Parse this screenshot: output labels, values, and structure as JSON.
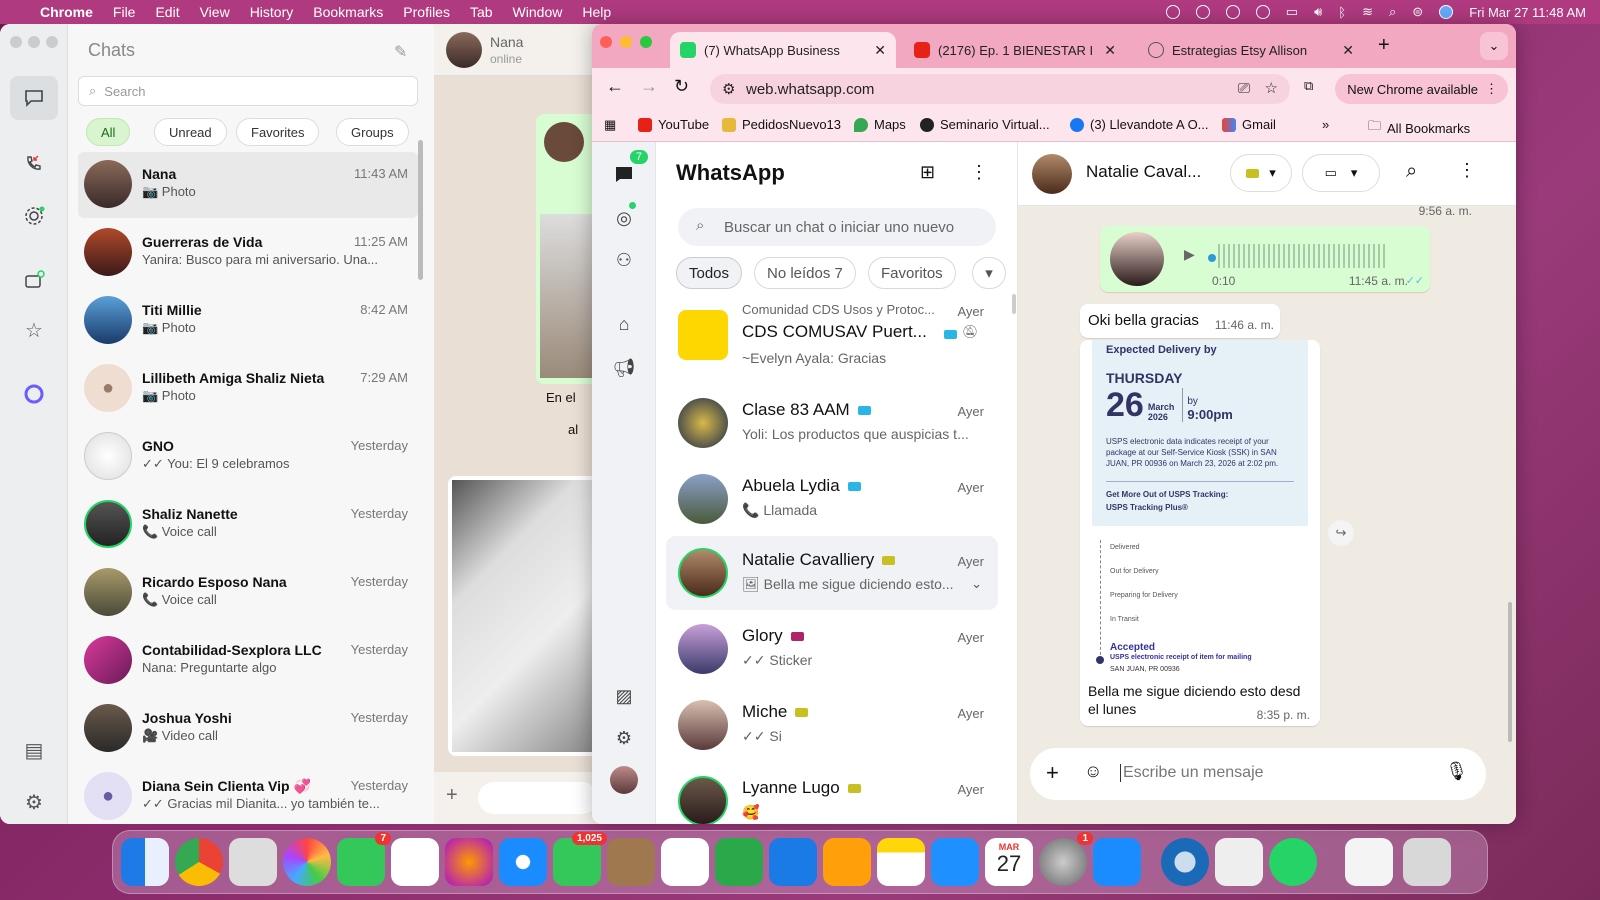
{
  "menubar": {
    "app": "Chrome",
    "items": [
      "File",
      "Edit",
      "View",
      "History",
      "Bookmarks",
      "Profiles",
      "Tab",
      "Window",
      "Help"
    ],
    "datetime": "Fri Mar 27  11:48 AM"
  },
  "messages_app": {
    "title": "Chats",
    "search_placeholder": "Search",
    "filters": [
      "All",
      "Unread",
      "Favorites",
      "Groups"
    ],
    "chats": [
      {
        "name": "Nana",
        "preview": "📷 Photo",
        "time": "11:43 AM"
      },
      {
        "name": "Guerreras de Vida",
        "preview": "Yanira: Busco para mi aniversario. Una...",
        "time": "11:25 AM"
      },
      {
        "name": "Titi Millie",
        "preview": "📷 Photo",
        "time": "8:42 AM"
      },
      {
        "name": "Lillibeth Amiga Shaliz Nieta",
        "preview": "📷 Photo",
        "time": "7:29 AM"
      },
      {
        "name": "GNO",
        "preview": "✓✓ You: El 9 celebramos",
        "time": "Yesterday"
      },
      {
        "name": "Shaliz Nanette",
        "preview": "📞 Voice call",
        "time": "Yesterday"
      },
      {
        "name": "Ricardo Esposo Nana",
        "preview": "📞 Voice call",
        "time": "Yesterday"
      },
      {
        "name": "Contabilidad-Sexplora LLC",
        "preview": "Nana: Preguntarte algo",
        "time": "Yesterday"
      },
      {
        "name": "Joshua Yoshi",
        "preview": "🎥 Video call",
        "time": "Yesterday"
      },
      {
        "name": "Diana Sein Clienta Vip 💞",
        "preview": "✓✓ Gracias mil Dianita... yo también te...",
        "time": "Yesterday"
      }
    ],
    "conversation": {
      "name": "Nana",
      "status": "online",
      "snippet": "En el",
      "snippet2": "al"
    }
  },
  "chrome": {
    "tabs": [
      {
        "title": "(7) WhatsApp Business",
        "active": true
      },
      {
        "title": "(2176) Ep. 1 BIENESTAR INTIM",
        "active": false
      },
      {
        "title": "Estrategias Etsy Allison",
        "active": false
      }
    ],
    "url": "web.whatsapp.com",
    "new_chrome": "New Chrome available",
    "bookmarks": [
      "YouTube",
      "PedidosNuevo13",
      "Maps",
      "Seminario Virtual...",
      "(3) Llevandote A O...",
      "Gmail"
    ],
    "all_bookmarks": "All Bookmarks"
  },
  "whatsapp": {
    "title": "WhatsApp",
    "chats_badge": "7",
    "search_placeholder": "Buscar un chat o iniciar uno nuevo",
    "filters": [
      "Todos",
      "No leídos 7",
      "Favoritos"
    ],
    "chats": [
      {
        "group": "Comunidad CDS Usos y Protoc...",
        "name": "CDS COMUSAV Puert...",
        "preview": "~Evelyn Ayala: Gracias",
        "time": "Ayer",
        "label": "#29b6e6"
      },
      {
        "name": "Clase 83 AAM",
        "preview": "Yoli: Los productos que auspicias t...",
        "time": "Ayer",
        "label": "#29b6e6"
      },
      {
        "name": "Abuela Lydia",
        "preview": "📞 Llamada",
        "time": "Ayer",
        "label": "#29b6e6"
      },
      {
        "name": "Natalie Cavalliery",
        "preview": "🖼 Bella me sigue diciendo esto...",
        "time": "Ayer",
        "label": "#c8c020"
      },
      {
        "name": "Glory",
        "preview": "✓✓ Sticker",
        "time": "Ayer",
        "label": "#b0236a"
      },
      {
        "name": "Miche",
        "preview": "✓✓ Si",
        "time": "Ayer",
        "label": "#c8c020"
      },
      {
        "name": "Lyanne Lugo",
        "preview": "🥰",
        "time": "Ayer",
        "label": "#c8c020"
      }
    ],
    "conversation": {
      "name": "Natalie Caval...",
      "prev_time": "9:56 a. m.",
      "voice_duration": "0:10",
      "voice_time": "11:45 a. m.",
      "msg1": "Oki bella gracias",
      "msg1_time": "11:46 a. m.",
      "usps": {
        "header": "Expected Delivery by",
        "day": "THURSDAY",
        "date": "26",
        "month": "March",
        "year": "2026",
        "by": "by",
        "hour": "9:00pm",
        "info": "USPS electronic data indicates receipt of your package at our Self-Service Kiosk (SSK) in SAN JUAN, PR 00936 on March 23, 2026 at 2:02 pm.",
        "more": "Get More Out of USPS Tracking:",
        "plus": "USPS Tracking Plus®",
        "steps": [
          "Delivered",
          "Out for Delivery",
          "Preparing for Delivery",
          "In Transit"
        ],
        "accepted": "Accepted",
        "accepted_sub": "USPS electronic receipt of item for mailing",
        "city": "SAN JUAN, PR 00936"
      },
      "caption": "Bella me sigue diciendo esto desd el lunes",
      "caption_time": "8:35 p. m.",
      "composer_placeholder": "Escribe un mensaje"
    }
  },
  "dock": {
    "facetime_badge": "7",
    "messages_badge": "1,025",
    "settings_badge": "1",
    "calendar_month": "MAR",
    "calendar_day": "27"
  }
}
